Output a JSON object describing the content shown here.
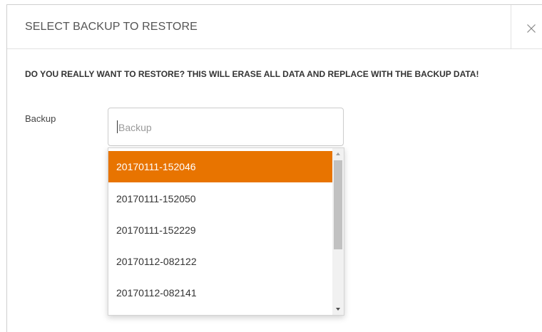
{
  "modal": {
    "title": "SELECT BACKUP TO RESTORE",
    "close_label": "×"
  },
  "warning": {
    "text": "DO YOU REALLY WANT TO RESTORE? THIS WILL ERASE ALL DATA AND REPLACE WITH THE BACKUP DATA!"
  },
  "backup_field": {
    "label": "Backup",
    "placeholder": "Backup",
    "value": ""
  },
  "dropdown": {
    "options": [
      {
        "label": "20170111-152046",
        "highlighted": true
      },
      {
        "label": "20170111-152050",
        "highlighted": false
      },
      {
        "label": "20170111-152229",
        "highlighted": false
      },
      {
        "label": "20170112-082122",
        "highlighted": false
      },
      {
        "label": "20170112-082141",
        "highlighted": false
      }
    ],
    "highlight_color": "#e87400"
  },
  "icons": {
    "close": "close-icon",
    "scroll_up": "scroll-up-arrow-icon",
    "scroll_down": "scroll-down-arrow-icon"
  }
}
